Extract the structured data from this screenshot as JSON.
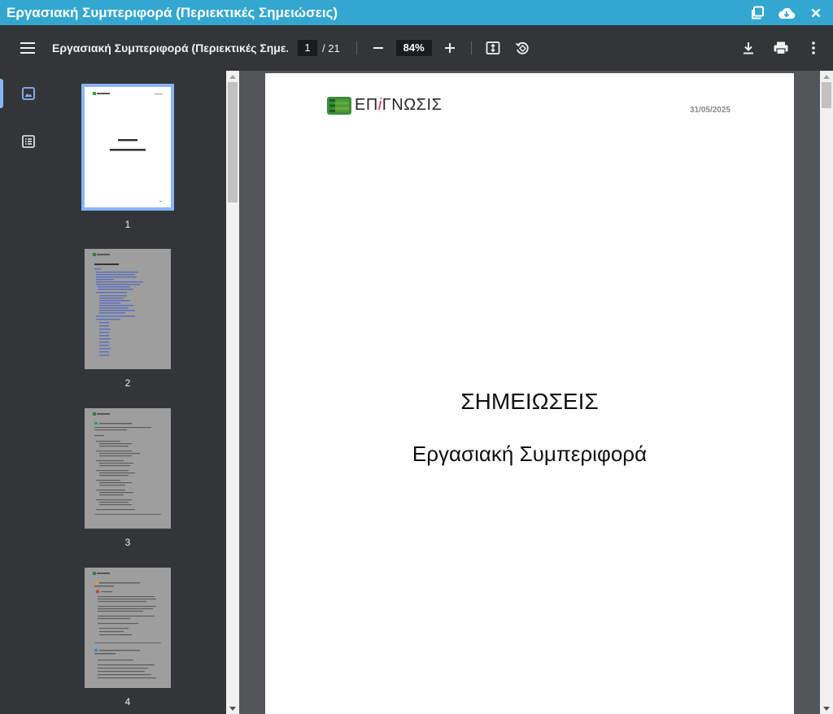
{
  "window": {
    "title": "Εργασιακή Συμπεριφορά (Περιεκτικές Σημειώσεις)",
    "actions": [
      "external-window-icon",
      "cloud-download-icon",
      "close-icon"
    ],
    "accent_color": "#33a7cf"
  },
  "toolbar": {
    "doc_title": "Εργασιακή Συμπεριφορά (Περιεκτικές Σημε...",
    "page_current": "1",
    "page_total": "/ 21",
    "zoom": "84%",
    "icons": [
      "menu-icon",
      "zoom-out-icon",
      "zoom-in-icon",
      "fit-page-icon",
      "rotate-icon",
      "download-icon",
      "print-icon",
      "more-vert-icon"
    ]
  },
  "sidebar": {
    "tabs": [
      "thumbnails-icon",
      "outline-icon"
    ],
    "active_tab": "thumbnails",
    "thumbnails": [
      {
        "number": "1",
        "active": true
      },
      {
        "number": "2",
        "active": false
      },
      {
        "number": "3",
        "active": false
      },
      {
        "number": "4",
        "active": false
      }
    ]
  },
  "page": {
    "logo_prefix": "ΕΠ",
    "logo_i": "i",
    "logo_suffix": "ΓΝΩΣΙΣ",
    "date": "31/05/2025",
    "heading": "ΣΗΜΕΙΩΣΕΙΣ",
    "subheading": "Εργασιακή Συμπεριφορά"
  }
}
